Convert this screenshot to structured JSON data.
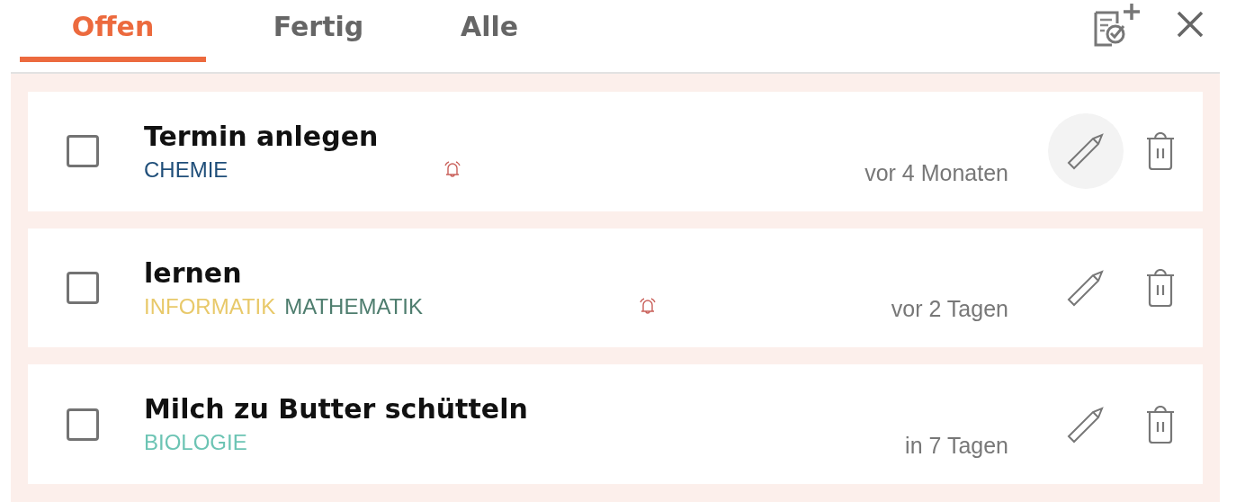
{
  "tabs": [
    {
      "label": "Offen",
      "selected": true
    },
    {
      "label": "Fertig",
      "selected": false
    },
    {
      "label": "Alle",
      "selected": false
    }
  ],
  "tasks": [
    {
      "title": "Termin anlegen",
      "done": false,
      "tags": [
        {
          "label": "CHEMIE",
          "color": "#1f4e79"
        }
      ],
      "alarm": true,
      "due": "vor 4 Monaten",
      "edit_highlighted": true
    },
    {
      "title": "lernen",
      "done": false,
      "tags": [
        {
          "label": "INFORMATIK",
          "color": "#e8c96a"
        },
        {
          "label": "MATHEMATIK",
          "color": "#4e7d6e"
        }
      ],
      "alarm": true,
      "due": "vor 2 Tagen",
      "edit_highlighted": false
    },
    {
      "title": "Milch zu Butter schütteln",
      "done": false,
      "tags": [
        {
          "label": "BIOLOGIE",
          "color": "#6cc4b4"
        }
      ],
      "alarm": false,
      "due": "in 7 Tagen",
      "edit_highlighted": false
    }
  ]
}
